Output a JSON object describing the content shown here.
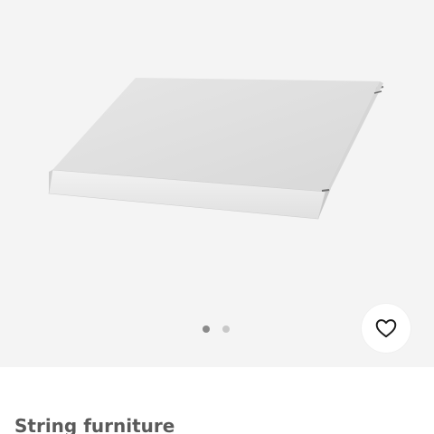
{
  "product": {
    "brand": "String furniture"
  },
  "gallery": {
    "slide_count": 2,
    "active_slide": 1,
    "dot_active_color": "#8a8a8a",
    "dot_inactive_color": "#c8c8c8"
  },
  "actions": {
    "favorite_icon": "heart-outline-icon"
  }
}
